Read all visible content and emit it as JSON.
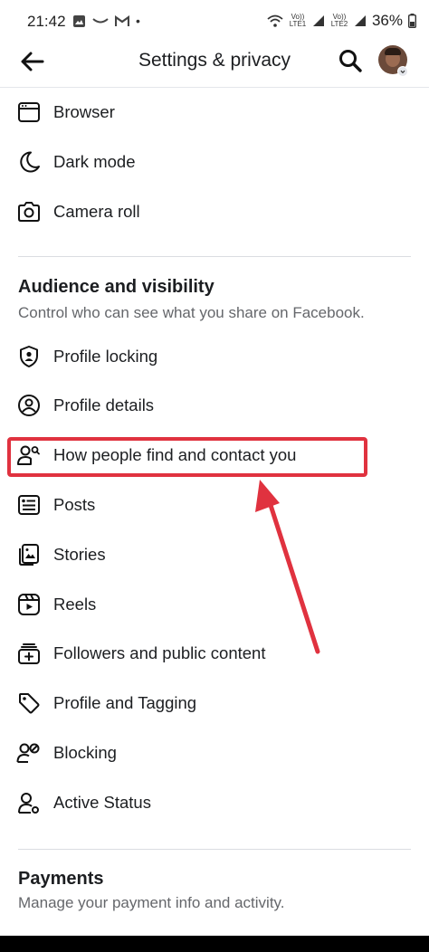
{
  "status_bar": {
    "time": "21:42",
    "dot": "•",
    "lte1": "Vo)) LTE1",
    "lte2": "Vo)) LTE2",
    "battery": "36%"
  },
  "header": {
    "title": "Settings & privacy"
  },
  "preferences_items": [
    {
      "label": "Browser",
      "icon": "browser-icon"
    },
    {
      "label": "Dark mode",
      "icon": "moon-icon"
    },
    {
      "label": "Camera roll",
      "icon": "camera-icon"
    }
  ],
  "audience_section": {
    "title": "Audience and visibility",
    "subtitle": "Control who can see what you share on Facebook.",
    "items": [
      {
        "label": "Profile locking",
        "icon": "shield-person-icon"
      },
      {
        "label": "Profile details",
        "icon": "person-circle-icon"
      },
      {
        "label": "How people find and contact you",
        "icon": "person-search-icon"
      },
      {
        "label": "Posts",
        "icon": "posts-icon"
      },
      {
        "label": "Stories",
        "icon": "stories-icon"
      },
      {
        "label": "Reels",
        "icon": "reels-icon"
      },
      {
        "label": "Followers and public content",
        "icon": "followers-icon"
      },
      {
        "label": "Profile and Tagging",
        "icon": "tag-icon"
      },
      {
        "label": "Blocking",
        "icon": "blocking-icon"
      },
      {
        "label": "Active Status",
        "icon": "active-status-icon"
      }
    ]
  },
  "payments_section": {
    "title": "Payments",
    "subtitle": "Manage your payment info and activity."
  },
  "annotation": {
    "highlight_color": "#e0323f"
  }
}
